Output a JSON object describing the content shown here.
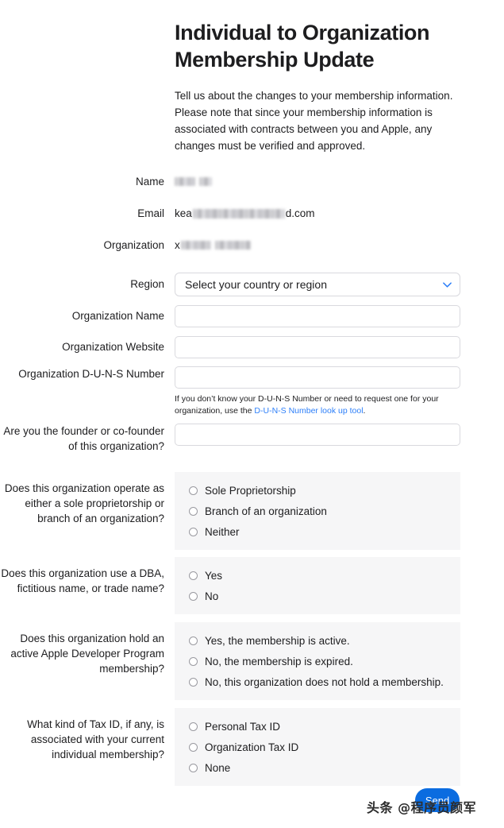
{
  "header": {
    "title": "Individual to Organization Membership Update",
    "intro": "Tell us about the changes to your membership information. Please note that since your membership information is associated with contracts between you and Apple, any changes must be verified and approved."
  },
  "readonly_fields": [
    {
      "label": "Name",
      "value_visible_prefix": "",
      "value_visible_suffix": "",
      "redacted": true
    },
    {
      "label": "Email",
      "value_visible_prefix": "kea",
      "value_visible_suffix": "d.com",
      "redacted": true
    },
    {
      "label": "Organization",
      "value_visible_prefix": "x",
      "value_visible_suffix": "",
      "redacted": true
    }
  ],
  "region": {
    "label": "Region",
    "selected": "Select your country or region",
    "icon": "chevron-down-icon"
  },
  "text_fields": [
    {
      "label": "Organization Name",
      "value": "",
      "placeholder": ""
    },
    {
      "label": "Organization Website",
      "value": "",
      "placeholder": ""
    },
    {
      "label": "Organization D-U-N-S Number",
      "value": "",
      "placeholder": ""
    },
    {
      "label": "Are you the founder or co-founder of this organization?",
      "value": "",
      "placeholder": ""
    }
  ],
  "duns_helper": {
    "text_before": "If you don’t know your D-U-N-S Number or need to request one for your organization, use the ",
    "link_text": "D-U-N-S Number look up tool",
    "text_after": "."
  },
  "radio_questions": [
    {
      "label": "Does this organization operate as either a sole proprietorship or branch of an organization?",
      "options": [
        "Sole Proprietorship",
        "Branch of an organization",
        "Neither"
      ]
    },
    {
      "label": "Does this organization use a DBA, fictitious name, or trade name?",
      "options": [
        "Yes",
        "No"
      ]
    },
    {
      "label": "Does this organization hold an active Apple Developer Program membership?",
      "options": [
        "Yes, the membership is active.",
        "No, the membership is expired.",
        "No, this organization does not hold a membership."
      ]
    },
    {
      "label": "What kind of Tax ID, if any, is associated with your current individual membership?",
      "options": [
        "Personal Tax ID",
        "Organization Tax ID",
        "None"
      ]
    }
  ],
  "send_button": {
    "label": "Send"
  },
  "watermark": {
    "text": "头条 @程序员颜军"
  },
  "colors": {
    "accent_blue": "#0b6ce0",
    "link_blue": "#2d7ff9",
    "text": "#1d1d1f",
    "border": "#d9d9de",
    "group_bg": "#f6f6f7"
  }
}
